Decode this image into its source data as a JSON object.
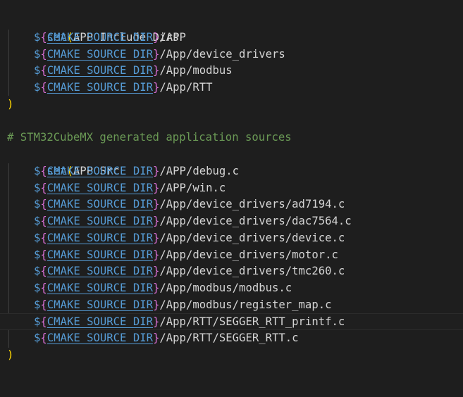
{
  "editor": {
    "block1": {
      "keyword": "set",
      "open_paren": "(",
      "name": "APP_Include_Dirs",
      "close_paren": ")",
      "entries": [
        {
          "dollar": "$",
          "lb": "{",
          "var": "CMAKE_SOURCE_DIR",
          "rb": "}",
          "path": "/APP"
        },
        {
          "dollar": "$",
          "lb": "{",
          "var": "CMAKE_SOURCE_DIR",
          "rb": "}",
          "path": "/App/device_drivers"
        },
        {
          "dollar": "$",
          "lb": "{",
          "var": "CMAKE_SOURCE_DIR",
          "rb": "}",
          "path": "/App/modbus"
        },
        {
          "dollar": "$",
          "lb": "{",
          "var": "CMAKE_SOURCE_DIR",
          "rb": "}",
          "path": "/App/RTT"
        }
      ]
    },
    "comment": "# STM32CubeMX generated application sources",
    "block2": {
      "keyword": "set",
      "open_paren": "(",
      "name": "APP_Src",
      "close_paren": ")",
      "entries": [
        {
          "dollar": "$",
          "lb": "{",
          "var": "CMAKE_SOURCE_DIR",
          "rb": "}",
          "path": "/APP/debug.c"
        },
        {
          "dollar": "$",
          "lb": "{",
          "var": "CMAKE_SOURCE_DIR",
          "rb": "}",
          "path": "/APP/win.c"
        },
        {
          "dollar": "$",
          "lb": "{",
          "var": "CMAKE_SOURCE_DIR",
          "rb": "}",
          "path": "/App/device_drivers/ad7194.c"
        },
        {
          "dollar": "$",
          "lb": "{",
          "var": "CMAKE_SOURCE_DIR",
          "rb": "}",
          "path": "/App/device_drivers/dac7564.c"
        },
        {
          "dollar": "$",
          "lb": "{",
          "var": "CMAKE_SOURCE_DIR",
          "rb": "}",
          "path": "/App/device_drivers/device.c"
        },
        {
          "dollar": "$",
          "lb": "{",
          "var": "CMAKE_SOURCE_DIR",
          "rb": "}",
          "path": "/App/device_drivers/motor.c"
        },
        {
          "dollar": "$",
          "lb": "{",
          "var": "CMAKE_SOURCE_DIR",
          "rb": "}",
          "path": "/App/device_drivers/tmc260.c"
        },
        {
          "dollar": "$",
          "lb": "{",
          "var": "CMAKE_SOURCE_DIR",
          "rb": "}",
          "path": "/App/modbus/modbus.c"
        },
        {
          "dollar": "$",
          "lb": "{",
          "var": "CMAKE_SOURCE_DIR",
          "rb": "}",
          "path": "/App/modbus/register_map.c"
        },
        {
          "dollar": "$",
          "lb": "{",
          "var": "CMAKE_SOURCE_DIR",
          "rb": "}",
          "path": "/App/RTT/SEGGER_RTT_printf.c"
        },
        {
          "dollar": "$",
          "lb": "{",
          "var": "CMAKE_SOURCE_DIR",
          "rb": "}",
          "path": "/App/RTT/SEGGER_RTT.c"
        }
      ]
    },
    "colors": {
      "background": "#1e1e1e",
      "keyword": "#569cd6",
      "paren": "#ffd700",
      "brace": "#da70d6",
      "comment": "#6a9955",
      "text": "#d4d4d4",
      "indent_guide": "#404040"
    }
  }
}
